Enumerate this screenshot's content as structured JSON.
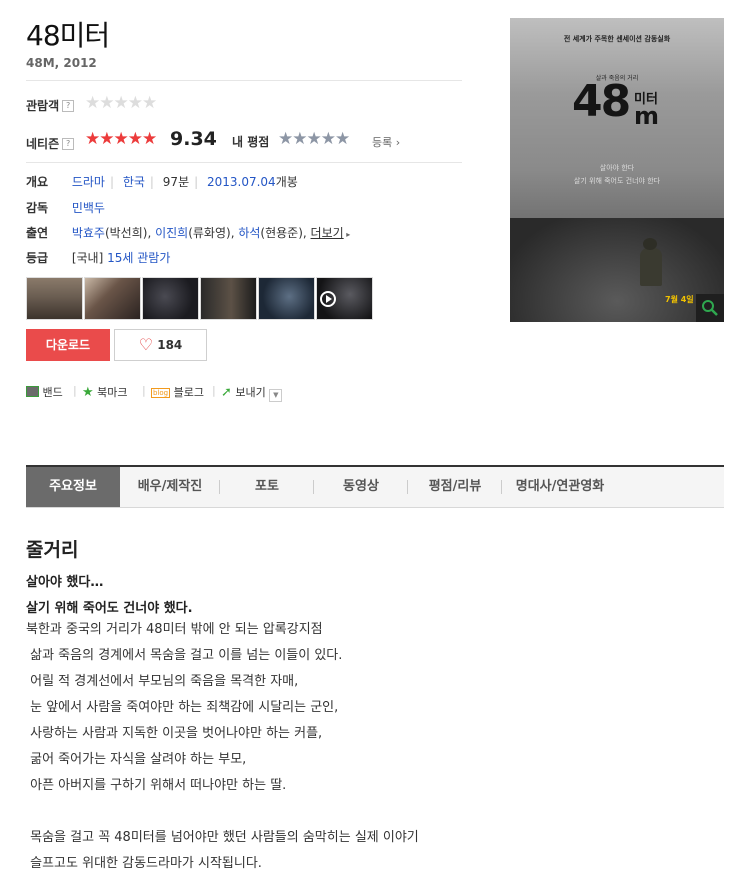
{
  "movie": {
    "title": "48미터",
    "subtitle": "48M, 2012"
  },
  "ratings": {
    "audience_label": "관람객",
    "netizen_label": "네티즌",
    "netizen_score": "9.34",
    "my_label": "내 평점",
    "register_label": "등록",
    "help_glyph": "?",
    "audience_stars": 0,
    "netizen_stars": 4.67,
    "my_stars": 0
  },
  "info": {
    "overview_label": "개요",
    "genre": "드라마",
    "country": "한국",
    "runtime": "97분",
    "release": "2013.07.04",
    "release_suffix": "개봉",
    "director_label": "감독",
    "director": "민백두",
    "cast_label": "출연",
    "cast": [
      {
        "name": "박효주",
        "role": "(박선희)"
      },
      {
        "name": "이진희",
        "role": "(류화영)"
      },
      {
        "name": "하석",
        "role": "(현용준)"
      }
    ],
    "more_label": "더보기",
    "grade_label": "등급",
    "grade_region": "[국내]",
    "grade": "15세 관람가"
  },
  "actions": {
    "download": "다운로드",
    "like_count": "184"
  },
  "share": {
    "band": "밴드",
    "bookmark": "북마크",
    "blog": "블로그",
    "send": "보내기",
    "blog_icon_text": "blog"
  },
  "tabs": [
    "주요정보",
    "배우/제작진",
    "포토",
    "동영상",
    "평점/리뷰",
    "명대사/연관영화"
  ],
  "plot": {
    "heading": "줄거리",
    "tagline1": "살아야 했다…",
    "tagline2": "살기 위해 죽어도 건너야 했다.",
    "body": "북한과 중국의 거리가 48미터 밖에 안 되는 압록강지점\n 삶과 죽음의 경계에서 목숨을 걸고 이를 넘는 이들이 있다.\n 어릴 적 경계선에서 부모님의 죽음을 목격한 자매,\n 눈 앞에서 사람을 죽여야만 하는 죄책감에 시달리는 군인,\n 사랑하는 사람과 지독한 이곳을 벗어나야만 하는 커플,\n 굶어 죽어가는 자식을 살려야 하는 부모,\n 아픈 아버지를 구하기 위해서 떠나야만 하는 딸.\n\n 목숨을 걸고 꼭 48미터를 넘어야만 했던 사람들의 숨막히는 실제 이야기\n 슬프고도 위대한 감동드라마가 시작됩니다."
  },
  "poster": {
    "top_line": "전 세계가 주목한 센세이션 감동실화",
    "small_line": "살과 죽음의 거리",
    "title_big": "48",
    "title_m": "m",
    "title_mid": "미터",
    "center_text1": "살아야 한다",
    "center_text2": "살기 위해 죽어도 건너야 한다",
    "date": "7월 4일",
    "accent": "#2fa84f"
  },
  "colors": {
    "download_bg": "#ea4b4b",
    "link": "#2456c5",
    "star_red": "#ec3b3b"
  }
}
